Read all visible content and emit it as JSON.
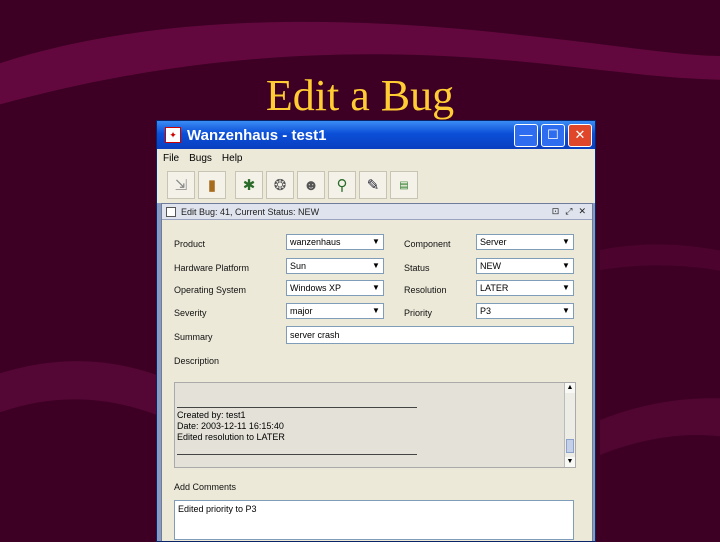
{
  "slide": {
    "title": "Edit a Bug"
  },
  "window": {
    "title": "Wanzenhaus - test1",
    "minimize": "—",
    "maximize": "☐",
    "close": "✕"
  },
  "menu": {
    "file": "File",
    "bugs": "Bugs",
    "help": "Help"
  },
  "internal_frame": {
    "title": "Edit Bug: 41, Current Status: NEW"
  },
  "form": {
    "product": {
      "label": "Product",
      "value": "wanzenhaus"
    },
    "component": {
      "label": "Component",
      "value": "Server"
    },
    "hardware_platform": {
      "label": "Hardware Platform",
      "value": "Sun"
    },
    "status": {
      "label": "Status",
      "value": "NEW"
    },
    "operating_system": {
      "label": "Operating System",
      "value": "Windows XP"
    },
    "resolution": {
      "label": "Resolution",
      "value": "LATER"
    },
    "severity": {
      "label": "Severity",
      "value": "major"
    },
    "priority": {
      "label": "Priority",
      "value": "P3"
    },
    "summary": {
      "label": "Summary",
      "value": "server crash"
    },
    "description": {
      "label": "Description",
      "lines": [
        "Created by: test1",
        "Date: 2003-12-11 16:15:40",
        "Edited resolution to LATER"
      ]
    },
    "add_comments": {
      "label": "Add Comments",
      "value": "Edited priority to P3"
    }
  },
  "colors": {
    "background": "#3d0024",
    "title": "#ffcc33",
    "titlebar": "#0b4fd8"
  }
}
